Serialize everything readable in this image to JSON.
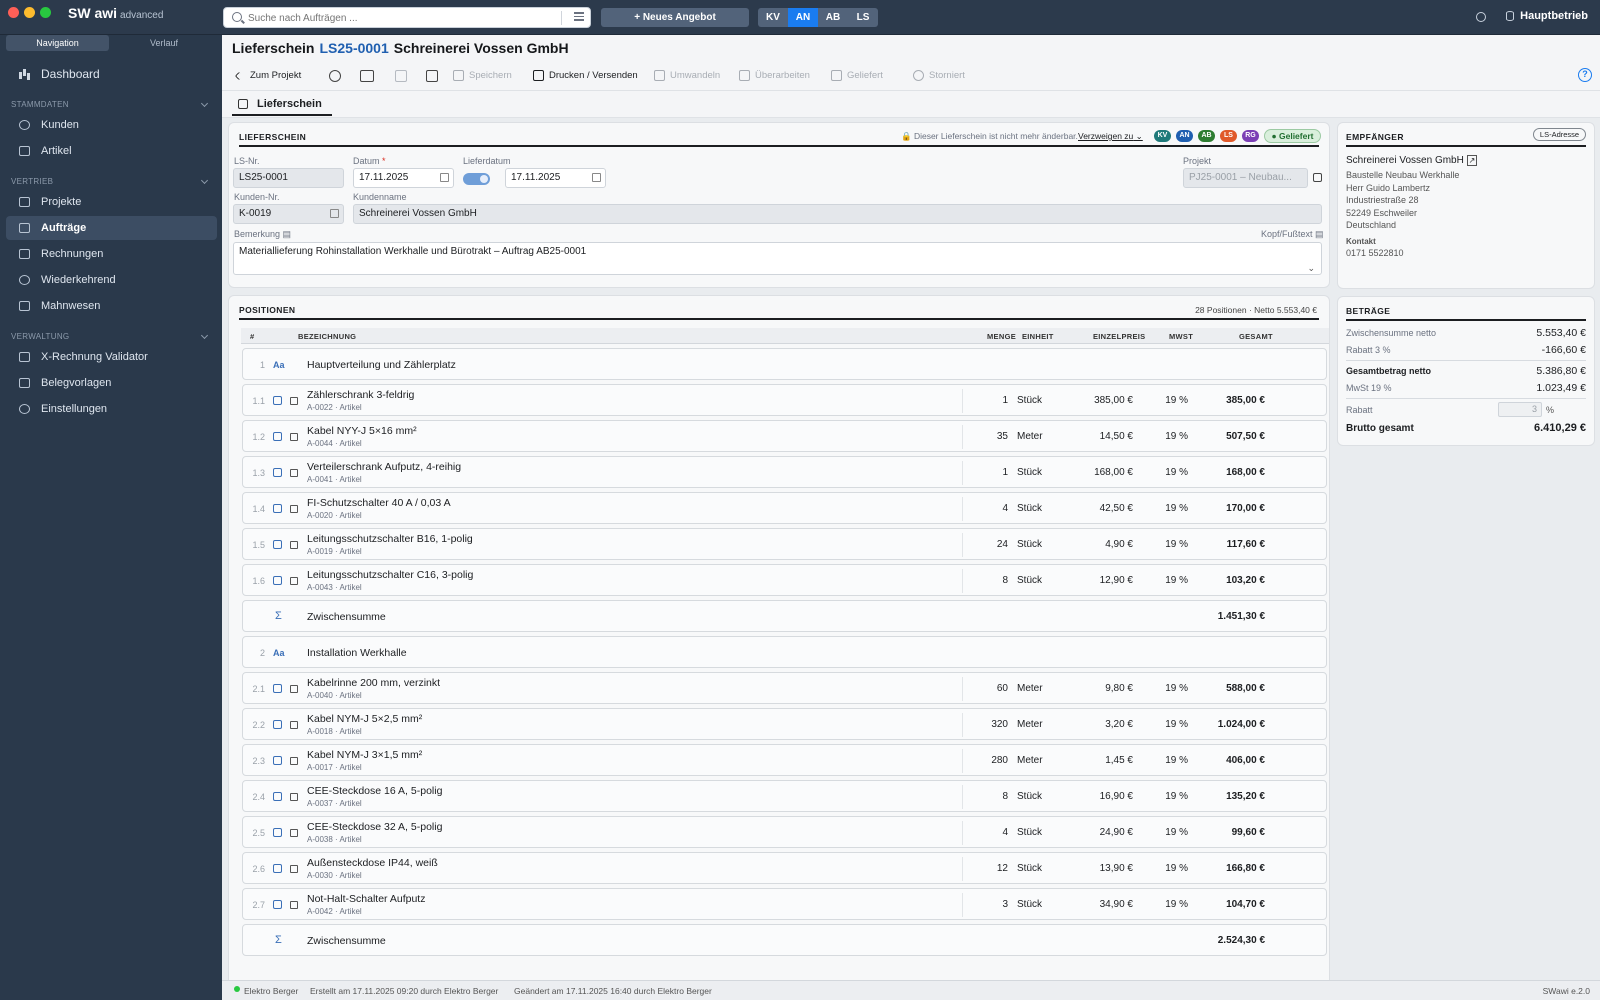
{
  "app": {
    "name": "SW awi",
    "edition": "advanced",
    "version": "SWawi e.2.0"
  },
  "topbar": {
    "search_placeholder": "Suche nach Aufträgen ...",
    "new_offer": "+ Neues Angebot",
    "doc_types": [
      "KV",
      "AN",
      "AB",
      "LS"
    ],
    "active_doc_type": "AN",
    "company": "Hauptbetrieb"
  },
  "sidebar": {
    "tabs": {
      "navigation": "Navigation",
      "history": "Verlauf"
    },
    "dashboard": "Dashboard",
    "sections": {
      "stammdaten": {
        "title": "STAMMDATEN",
        "items": [
          "Kunden",
          "Artikel"
        ]
      },
      "vertrieb": {
        "title": "VERTRIEB",
        "items": [
          "Projekte",
          "Aufträge",
          "Rechnungen",
          "Wiederkehrend",
          "Mahnwesen"
        ]
      },
      "verwaltung": {
        "title": "VERWALTUNG",
        "items": [
          "X-Rechnung Validator",
          "Belegvorlagen",
          "Einstellungen"
        ]
      }
    },
    "active_item": "Aufträge"
  },
  "header": {
    "doc_type": "Lieferschein",
    "doc_number": "LS25-0001",
    "customer": "Schreinerei Vossen GmbH"
  },
  "toolbar": {
    "to_project": "Zum Projekt",
    "save": "Speichern",
    "print_send": "Drucken / Versenden",
    "convert": "Umwandeln",
    "revise": "Überarbeiten",
    "delivered": "Geliefert",
    "cancelled": "Storniert"
  },
  "tab": {
    "label": "Lieferschein"
  },
  "form": {
    "title": "LIEFERSCHEIN",
    "lock_notice": "Dieser Lieferschein ist nicht mehr änderbar.",
    "branch_link": "Verzweigen zu",
    "badges": [
      {
        "label": "KV",
        "color": "#1f7a7a"
      },
      {
        "label": "AN",
        "color": "#1f5fb0"
      },
      {
        "label": "AB",
        "color": "#2e7d32"
      },
      {
        "label": "LS",
        "color": "#e0592a"
      },
      {
        "label": "RG",
        "color": "#7b3fb5"
      }
    ],
    "status": "Geliefert",
    "labels": {
      "ls_nr": "LS-Nr.",
      "datum": "Datum",
      "lieferdatum": "Lieferdatum",
      "projekt": "Projekt",
      "kunden_nr": "Kunden-Nr.",
      "kundenname": "Kundenname",
      "bemerkung": "Bemerkung",
      "kopf_fusstext": "Kopf/Fußtext"
    },
    "ls_nr": "LS25-0001",
    "datum": "17.11.2025",
    "lieferdatum": "17.11.2025",
    "projekt": "PJ25-0001 – Neubau...",
    "kunden_nr": "K-0019",
    "kundenname": "Schreinerei Vossen GmbH",
    "bemerkung": "Materiallieferung Rohinstallation Werkhalle und Bürotrakt – Auftrag AB25-0001"
  },
  "positions": {
    "title": "POSITIONEN",
    "summary": "28 Positionen · Netto 5.553,40 €",
    "columns": [
      "#",
      "BEZEICHNUNG",
      "MENGE",
      "EINHEIT",
      "EINZELPREIS",
      "MWST",
      "GESAMT"
    ],
    "rows": [
      {
        "kind": "group",
        "no": "1",
        "name": "Hauptverteilung und Zählerplatz"
      },
      {
        "kind": "item",
        "no": "1.1",
        "name": "Zählerschrank 3-feldrig",
        "sub": "A-0022 · Artikel",
        "qty": "1",
        "unit": "Stück",
        "price": "385,00 €",
        "vat": "19 %",
        "total": "385,00 €"
      },
      {
        "kind": "item",
        "no": "1.2",
        "name": "Kabel NYY-J 5×16 mm²",
        "sub": "A-0044 · Artikel",
        "qty": "35",
        "unit": "Meter",
        "price": "14,50 €",
        "vat": "19 %",
        "total": "507,50 €"
      },
      {
        "kind": "item",
        "no": "1.3",
        "name": "Verteilerschrank Aufputz, 4-reihig",
        "sub": "A-0041 · Artikel",
        "qty": "1",
        "unit": "Stück",
        "price": "168,00 €",
        "vat": "19 %",
        "total": "168,00 €"
      },
      {
        "kind": "item",
        "no": "1.4",
        "name": "FI-Schutzschalter 40 A / 0,03 A",
        "sub": "A-0020 · Artikel",
        "qty": "4",
        "unit": "Stück",
        "price": "42,50 €",
        "vat": "19 %",
        "total": "170,00 €"
      },
      {
        "kind": "item",
        "no": "1.5",
        "name": "Leitungsschutzschalter B16, 1-polig",
        "sub": "A-0019 · Artikel",
        "qty": "24",
        "unit": "Stück",
        "price": "4,90 €",
        "vat": "19 %",
        "total": "117,60 €"
      },
      {
        "kind": "item",
        "no": "1.6",
        "name": "Leitungsschutzschalter C16, 3-polig",
        "sub": "A-0043 · Artikel",
        "qty": "8",
        "unit": "Stück",
        "price": "12,90 €",
        "vat": "19 %",
        "total": "103,20 €"
      },
      {
        "kind": "subtotal",
        "name": "Zwischensumme",
        "total": "1.451,30 €"
      },
      {
        "kind": "group",
        "no": "2",
        "name": "Installation Werkhalle"
      },
      {
        "kind": "item",
        "no": "2.1",
        "name": "Kabelrinne 200 mm, verzinkt",
        "sub": "A-0040 · Artikel",
        "qty": "60",
        "unit": "Meter",
        "price": "9,80 €",
        "vat": "19 %",
        "total": "588,00 €"
      },
      {
        "kind": "item",
        "no": "2.2",
        "name": "Kabel NYM-J 5×2,5 mm²",
        "sub": "A-0018 · Artikel",
        "qty": "320",
        "unit": "Meter",
        "price": "3,20 €",
        "vat": "19 %",
        "total": "1.024,00 €"
      },
      {
        "kind": "item",
        "no": "2.3",
        "name": "Kabel NYM-J 3×1,5 mm²",
        "sub": "A-0017 · Artikel",
        "qty": "280",
        "unit": "Meter",
        "price": "1,45 €",
        "vat": "19 %",
        "total": "406,00 €"
      },
      {
        "kind": "item",
        "no": "2.4",
        "name": "CEE-Steckdose 16 A, 5-polig",
        "sub": "A-0037 · Artikel",
        "qty": "8",
        "unit": "Stück",
        "price": "16,90 €",
        "vat": "19 %",
        "total": "135,20 €"
      },
      {
        "kind": "item",
        "no": "2.5",
        "name": "CEE-Steckdose 32 A, 5-polig",
        "sub": "A-0038 · Artikel",
        "qty": "4",
        "unit": "Stück",
        "price": "24,90 €",
        "vat": "19 %",
        "total": "99,60 €"
      },
      {
        "kind": "item",
        "no": "2.6",
        "name": "Außensteckdose IP44, weiß",
        "sub": "A-0030 · Artikel",
        "qty": "12",
        "unit": "Stück",
        "price": "13,90 €",
        "vat": "19 %",
        "total": "166,80 €"
      },
      {
        "kind": "item",
        "no": "2.7",
        "name": "Not-Halt-Schalter Aufputz",
        "sub": "A-0042 · Artikel",
        "qty": "3",
        "unit": "Stück",
        "price": "34,90 €",
        "vat": "19 %",
        "total": "104,70 €"
      },
      {
        "kind": "subtotal",
        "name": "Zwischensumme",
        "total": "2.524,30 €"
      }
    ]
  },
  "recipient": {
    "title": "EMPFÄNGER",
    "button": "LS-Adresse",
    "name": "Schreinerei Vossen GmbH",
    "lines": [
      "Baustelle Neubau Werkhalle",
      "Herr Guido Lambertz",
      "Industriestraße 28",
      "52249 Eschweiler",
      "Deutschland"
    ],
    "contact_label": "Kontakt",
    "phone": "0171 5522810"
  },
  "amounts": {
    "title": "BETRÄGE",
    "subtotal_label": "Zwischensumme netto",
    "subtotal": "5.553,40 €",
    "discount_label": "Rabatt 3 %",
    "discount": "-166,60 €",
    "net_label": "Gesamtbetrag netto",
    "net": "5.386,80 €",
    "vat_label": "MwSt 19 %",
    "vat": "1.023,49 €",
    "rabatt_label": "Rabatt",
    "rabatt_value": "3",
    "rabatt_unit": "%",
    "gross_label": "Brutto gesamt",
    "gross": "6.410,29 €"
  },
  "statusbar": {
    "user": "Elektro Berger",
    "created": "Erstellt am 17.11.2025 09:20 durch Elektro Berger",
    "changed": "Geändert am 17.11.2025 16:40 durch Elektro Berger"
  }
}
